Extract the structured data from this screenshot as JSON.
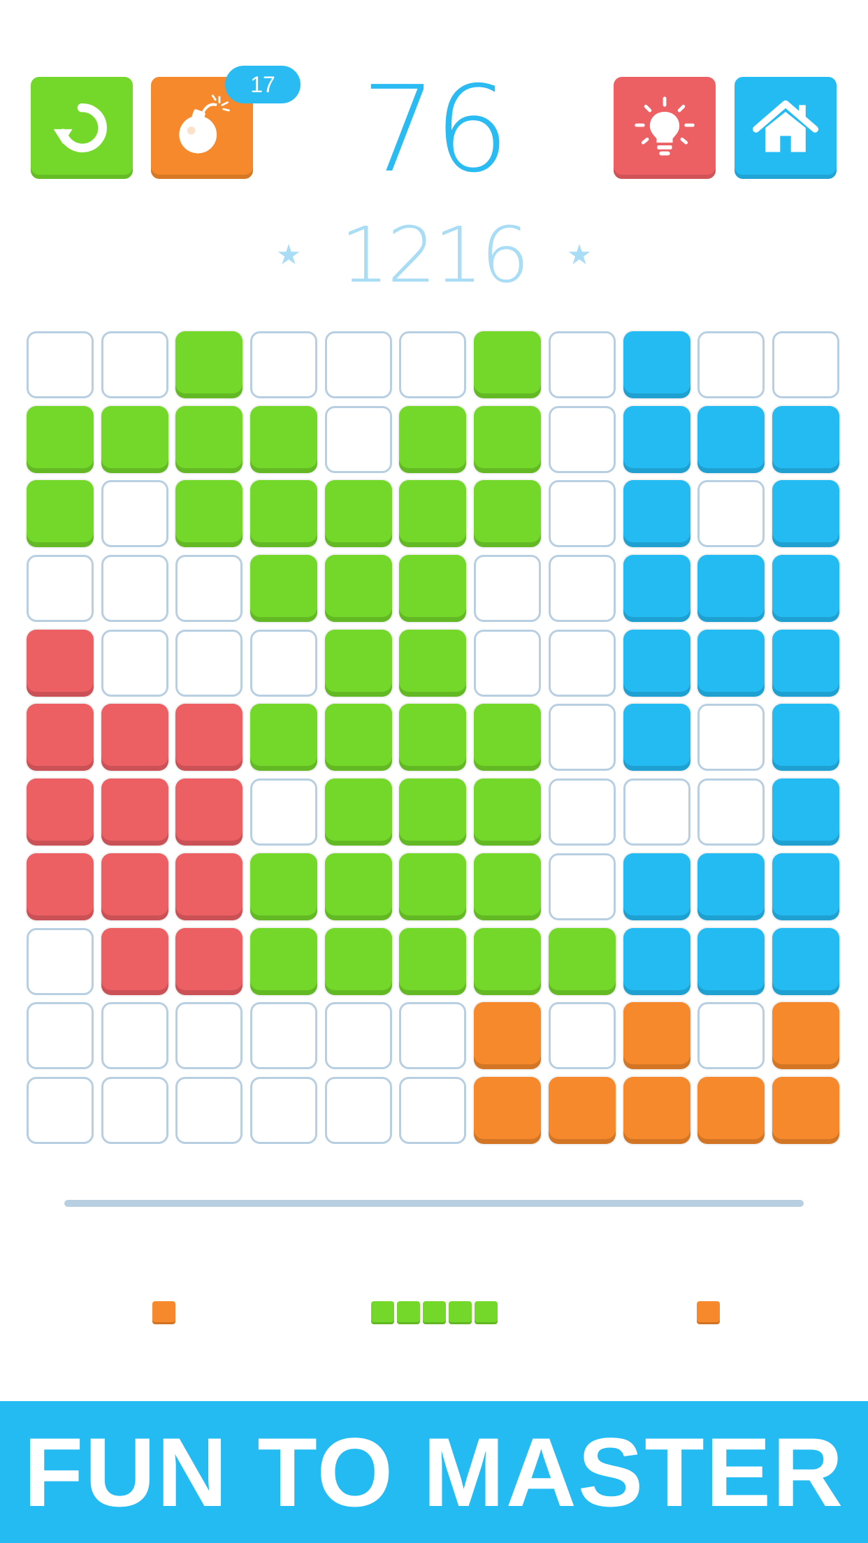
{
  "header": {
    "buttons": {
      "restart": {
        "icon": "restart-icon",
        "color": "#74d82b"
      },
      "bomb": {
        "icon": "bomb-icon",
        "color": "#f5892b",
        "badge_count": "17",
        "badge_color": "#2bbbf3"
      },
      "hint": {
        "icon": "lightbulb-icon",
        "color": "#ec5f63"
      },
      "home": {
        "icon": "home-icon",
        "color": "#24bbf3"
      }
    },
    "score": "76",
    "score_color": "#2bbbf3",
    "best_score": "1216",
    "best_color": "#a9dcf5"
  },
  "board": {
    "size": 11,
    "palette": {
      "G": "#74d82b",
      "B": "#24bbf3",
      "R": "#ec5f63",
      "O": "#f5892b"
    },
    "empty_border": "#b8cfe2",
    "rows": [
      "..G...G.B..",
      "GGGG.GG.BBB",
      "G.GGGGG.B.B",
      "...GGG..BBB",
      "R...GG..BBB",
      "RRRGGGG.B.B",
      "RRR.GGG...B",
      "RRRGGGG.BBB",
      ".RRGGGGGBBB",
      "......O.O.O",
      "......OOOOO"
    ]
  },
  "divider_color": "#b8cfe2",
  "pieces": [
    {
      "color": "#f5892b",
      "blocks": 1
    },
    {
      "color": "#74d82b",
      "blocks": 5
    },
    {
      "color": "#f5892b",
      "blocks": 1
    }
  ],
  "banner": {
    "text": "FUN TO MASTER",
    "color": "#24bbf3"
  }
}
